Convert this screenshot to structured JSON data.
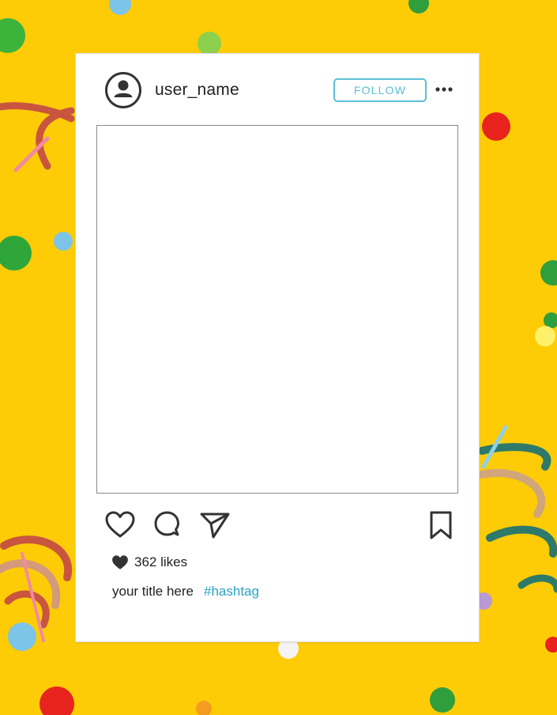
{
  "post": {
    "username": "user_name",
    "follow_label": "FOLLOW",
    "likes_text": "362 likes",
    "caption_title": "your title here",
    "hashtag": "#hashtag"
  },
  "icons": {
    "avatar": "user-avatar-icon",
    "more": "more-options-icon",
    "like": "heart-icon",
    "comment": "comment-bubble-icon",
    "share": "paper-plane-icon",
    "save": "bookmark-icon",
    "likes_heart": "filled-heart-icon"
  },
  "colors": {
    "background": "#fdcc07",
    "follow_accent": "#5bbfd6",
    "hashtag": "#29a3c9"
  }
}
